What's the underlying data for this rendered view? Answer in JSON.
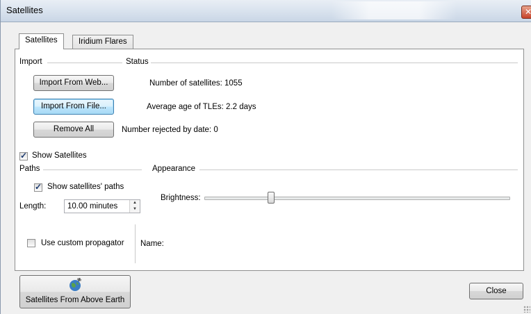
{
  "window": {
    "title": "Satellites"
  },
  "tabs": [
    {
      "label": "Satellites",
      "active": true
    },
    {
      "label": "Iridium Flares",
      "active": false
    }
  ],
  "import_group": {
    "title": "Import",
    "import_web_label": "Import From Web...",
    "import_file_label": "Import From File...",
    "remove_all_label": "Remove All"
  },
  "status_group": {
    "title": "Status",
    "num_satellites": "Number of satellites: 1055",
    "avg_age": "Average age of TLEs: 2.2 days",
    "num_rejected": "Number rejected by date: 0"
  },
  "show_satellites": {
    "label": "Show Satellites",
    "checked": true
  },
  "paths_group": {
    "title": "Paths",
    "show_paths_label": "Show satellites' paths",
    "show_paths_checked": true,
    "length_label": "Length:",
    "length_value": "10.00 minutes"
  },
  "appearance_group": {
    "title": "Appearance",
    "brightness_label": "Brightness:",
    "brightness_level": 0.22
  },
  "propagator": {
    "custom_label": "Use custom propagator",
    "custom_checked": false,
    "name_label": "Name:"
  },
  "footer": {
    "from_above_label": "Satellites From Above Earth",
    "from_above_icon": "globe-satellite-icon",
    "close_label": "Close"
  },
  "colors": {
    "titlebar": "#dbe4ef",
    "panel": "#ffffff",
    "close_x": "#c7432a"
  }
}
